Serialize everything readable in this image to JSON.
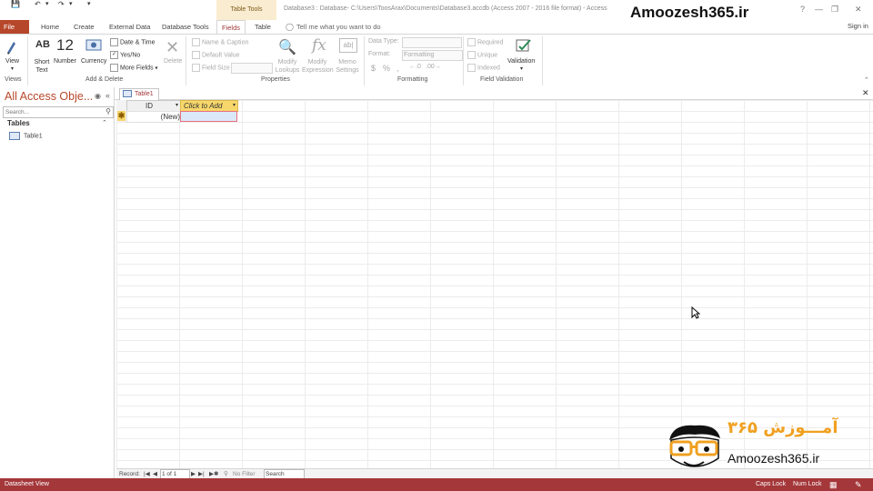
{
  "titlebar": {
    "table_tools": "Table Tools",
    "window_title": "Database3 : Database- C:\\Users\\ToosArax\\Documents\\Database3.accdb (Access 2007 - 2016 file format) - Access",
    "watermark": "Amoozesh365.ir"
  },
  "tabs": {
    "file": "File",
    "home": "Home",
    "create": "Create",
    "external_data": "External Data",
    "database_tools": "Database Tools",
    "fields": "Fields",
    "table": "Table",
    "tell_me": "Tell me what you want to do",
    "sign_in": "Sign in"
  },
  "ribbon": {
    "views": {
      "view": "View",
      "label": "Views"
    },
    "add_delete": {
      "ab": "AB",
      "short_text": "Short Text",
      "twelve": "12",
      "number": "Number",
      "currency": "Currency",
      "date_time": "Date & Time",
      "yes_no": "Yes/No",
      "more_fields": "More Fields",
      "delete": "Delete",
      "label": "Add & Delete"
    },
    "properties": {
      "name_caption": "Name & Caption",
      "default_value": "Default Value",
      "field_size": "Field Size",
      "modify_lookups": "Modify Lookups",
      "modify_expression": "Modify Expression",
      "memo_settings": "Memo Settings",
      "label": "Properties"
    },
    "formatting": {
      "data_type": "Data Type:",
      "format": "Format:",
      "format_value": "Formatting",
      "currency_sym": "$",
      "percent_sym": "%",
      "comma_sym": ",",
      "label": "Formatting"
    },
    "field_validation": {
      "required": "Required",
      "unique": "Unique",
      "indexed": "Indexed",
      "validation": "Validation",
      "label": "Field Validation"
    }
  },
  "nav_pane": {
    "title": "All Access Obje...",
    "search_placeholder": "Search...",
    "group": "Tables",
    "items": [
      "Table1"
    ]
  },
  "document": {
    "tab": "Table1",
    "columns": [
      "ID",
      "Click to Add"
    ],
    "new_row_label": "(New)"
  },
  "record_nav": {
    "record_label": "Record:",
    "position": "1 of 1",
    "filter": "No Filter",
    "search": "Search"
  },
  "statusbar": {
    "view": "Datasheet View",
    "caps_lock": "Caps Lock",
    "num_lock": "Num Lock"
  },
  "logo": {
    "persian": "آمـــوزش ۳۶۵",
    "latin": "Amoozesh365.ir"
  },
  "colors": {
    "access_red": "#a4373a",
    "file_tab": "#b7472a",
    "click_to_add": "#f7d76b",
    "table_tools": "#faecd0"
  }
}
